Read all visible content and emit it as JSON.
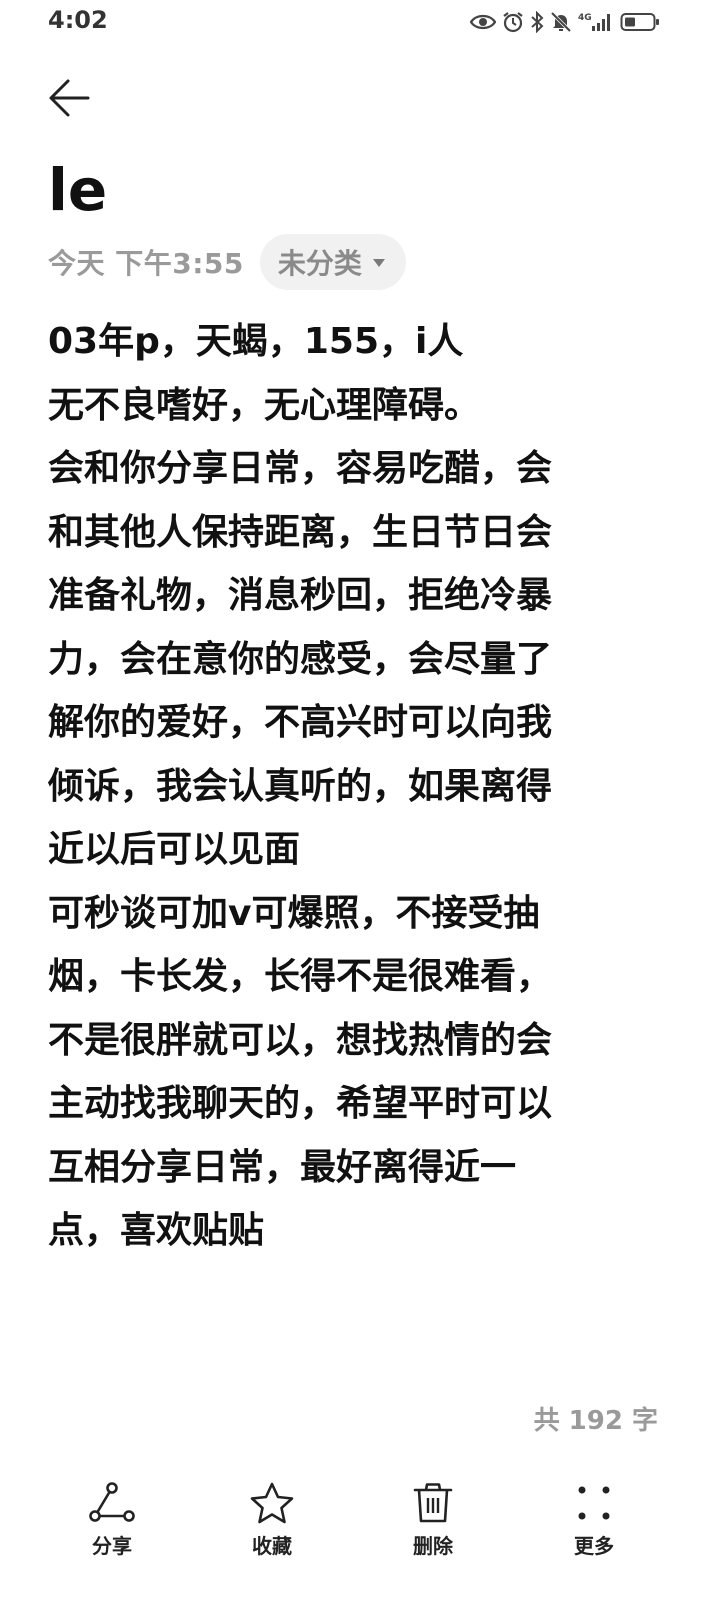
{
  "status_bar": {
    "time": "4:02",
    "network_label": "4G",
    "icons": [
      "eye-icon",
      "alarm-icon",
      "bluetooth-icon",
      "mute-icon",
      "signal-icon",
      "battery-icon"
    ]
  },
  "header": {
    "back_icon": "back-arrow-icon"
  },
  "note": {
    "title": "le",
    "date": "今天 下午3:55",
    "category": "未分类",
    "lines": [
      "03年p，天蝎，155，i人",
      "无不良嗜好，无心理障碍。",
      "会和你分享日常，容易吃醋，会",
      "和其他人保持距离，生日节日会",
      "准备礼物，消息秒回，拒绝冷暴",
      "力，会在意你的感受，会尽量了",
      "解你的爱好，不高兴时可以向我",
      "倾诉，我会认真听的，如果离得",
      "近以后可以见面",
      "可秒谈可加v可爆照，不接受抽",
      "烟，卡长发，长得不是很难看，",
      "不是很胖就可以，想找热情的会",
      "主动找我聊天的，希望平时可以",
      "互相分享日常，最好离得近一",
      "点，喜欢贴贴"
    ],
    "word_count": "共 192 字"
  },
  "toolbar": {
    "share": {
      "label": "分享",
      "icon": "share-icon"
    },
    "favorite": {
      "label": "收藏",
      "icon": "star-icon"
    },
    "delete": {
      "label": "删除",
      "icon": "trash-icon"
    },
    "more": {
      "label": "更多",
      "icon": "more-dots-icon"
    }
  },
  "colors": {
    "text": "#111111",
    "muted": "#9a9a9a",
    "chip_bg": "#f1f1f1",
    "background": "#ffffff"
  }
}
